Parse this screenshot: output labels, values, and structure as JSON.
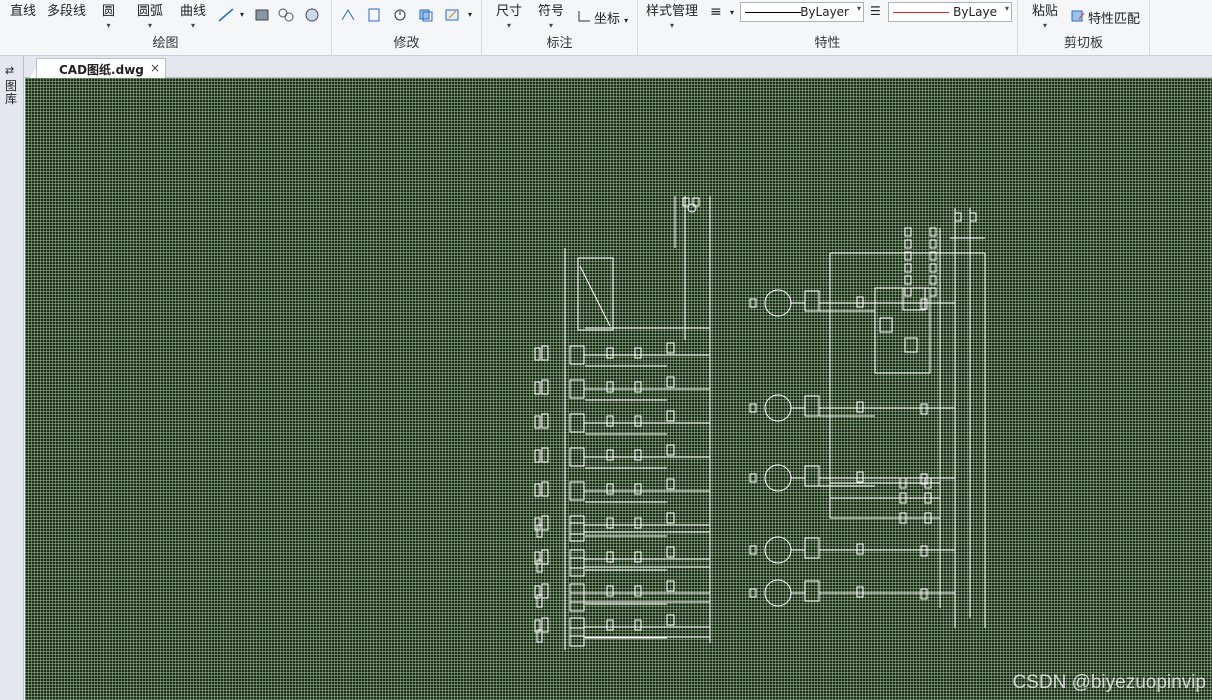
{
  "ribbon": {
    "draw": {
      "title": "绘图",
      "line": "直线",
      "polyline": "多段线",
      "circle": "圆",
      "arc": "圆弧",
      "curve": "曲线"
    },
    "modify": {
      "title": "修改"
    },
    "annotate": {
      "title": "标注",
      "dimension": "尺寸",
      "symbol": "符号",
      "coordinate": "坐标"
    },
    "properties": {
      "title": "特性",
      "style_manager": "样式管理",
      "linetype": "ByLayer",
      "color": "ByLaye"
    },
    "clipboard": {
      "title": "剪切板",
      "paste": "粘贴",
      "match_properties": "特性匹配"
    }
  },
  "document": {
    "tab_name": "CAD图纸.dwg",
    "close": "×"
  },
  "palette": {
    "pin": "⇄",
    "label": "图库"
  },
  "canvas": {
    "watermark": "CSDN @biyezuopinvip"
  },
  "colors": {
    "canvas_bg": "#1f2a1d",
    "grid": "#96be8c",
    "drawing": "#ffffff",
    "color_line": "#d22222"
  }
}
